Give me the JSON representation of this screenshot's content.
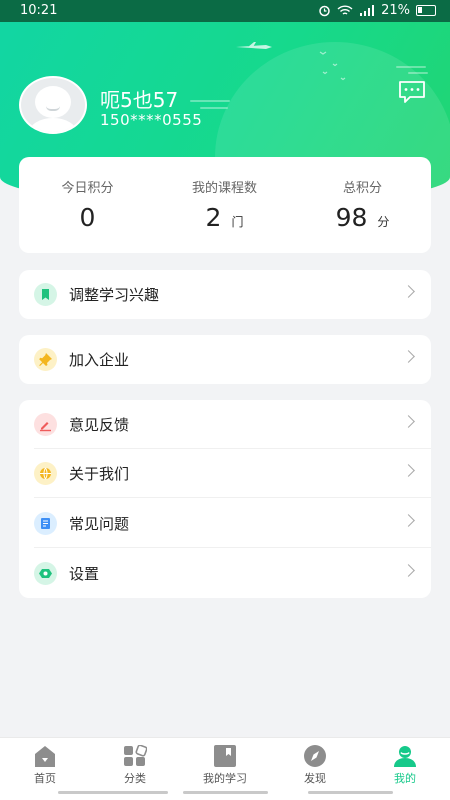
{
  "statusbar": {
    "time": "10:21",
    "battery": "21%"
  },
  "profile": {
    "name": "呃5也57",
    "phone": "150****0555"
  },
  "stats": [
    {
      "label": "今日积分",
      "value": "0",
      "unit": ""
    },
    {
      "label": "我的课程数",
      "value": "2",
      "unit": "门"
    },
    {
      "label": "总积分",
      "value": "98",
      "unit": "分"
    }
  ],
  "menu": {
    "interest": "调整学习兴趣",
    "join": "加入企业",
    "feedback": "意见反馈",
    "about": "关于我们",
    "faq": "常见问题",
    "settings": "设置"
  },
  "tabs": [
    {
      "label": "首页"
    },
    {
      "label": "分类"
    },
    {
      "label": "我的学习"
    },
    {
      "label": "发现"
    },
    {
      "label": "我的",
      "active": true
    }
  ],
  "colors": {
    "accent": "#16d98c",
    "active_tab": "#16c98a"
  }
}
